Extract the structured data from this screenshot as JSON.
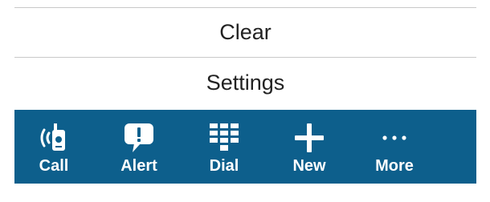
{
  "menu": {
    "items": [
      {
        "label": "Clear"
      },
      {
        "label": "Settings"
      }
    ]
  },
  "tabbar": {
    "background": "#0d5f8c",
    "tabs": [
      {
        "label": "Call",
        "icon": "radio-call-icon"
      },
      {
        "label": "Alert",
        "icon": "alert-bubble-icon"
      },
      {
        "label": "Dial",
        "icon": "dialpad-icon"
      },
      {
        "label": "New",
        "icon": "plus-icon"
      },
      {
        "label": "More",
        "icon": "more-dots-icon"
      }
    ]
  }
}
